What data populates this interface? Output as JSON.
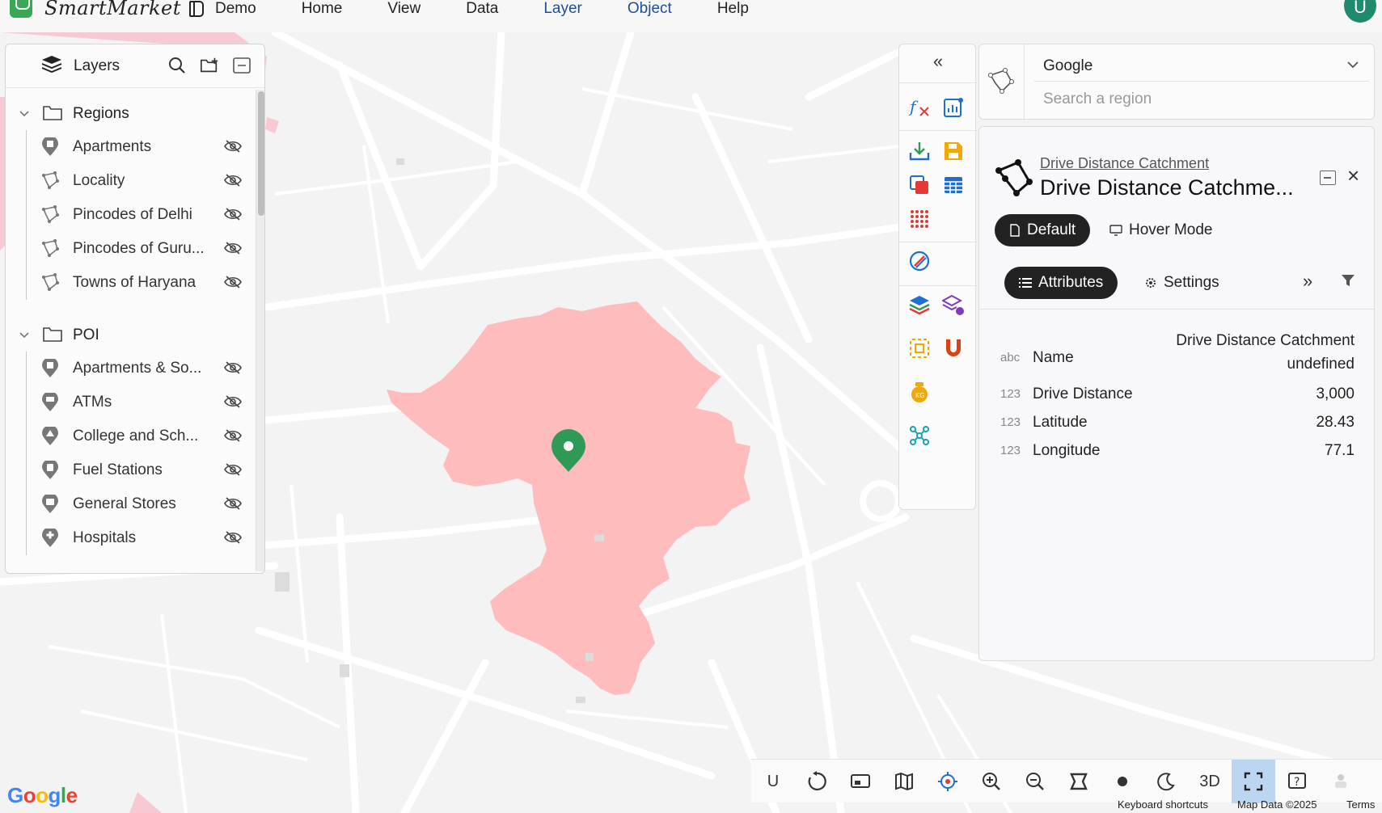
{
  "app": {
    "brand": "SmartMarket",
    "avatar_initial": "U",
    "menu": [
      {
        "label": "Demo",
        "icon": "book-icon",
        "active": false
      },
      {
        "label": "Home",
        "active": false
      },
      {
        "label": "View",
        "active": false
      },
      {
        "label": "Data",
        "active": false
      },
      {
        "label": "Layer",
        "active": true
      },
      {
        "label": "Object",
        "active": true
      },
      {
        "label": "Help",
        "active": false
      }
    ]
  },
  "layers_panel": {
    "title": "Layers",
    "groups": [
      {
        "label": "Regions",
        "items": [
          {
            "label": "Apartments",
            "icon": "pin-icon"
          },
          {
            "label": "Locality",
            "icon": "polygon-icon"
          },
          {
            "label": "Pincodes of Delhi",
            "icon": "polygon-icon"
          },
          {
            "label": "Pincodes of Guru...",
            "icon": "polygon-icon"
          },
          {
            "label": "Towns of Haryana",
            "icon": "polygon-icon"
          }
        ]
      },
      {
        "label": "POI",
        "items": [
          {
            "label": "Apartments & So...",
            "icon": "pin-icon"
          },
          {
            "label": "ATMs",
            "icon": "pin-icon"
          },
          {
            "label": "College and Sch...",
            "icon": "pin-icon"
          },
          {
            "label": "Fuel Stations",
            "icon": "pin-icon"
          },
          {
            "label": "General Stores",
            "icon": "pin-icon"
          },
          {
            "label": "Hospitals",
            "icon": "pin-icon"
          }
        ]
      }
    ]
  },
  "tool_strip": {
    "collapse_label": "«"
  },
  "region_search": {
    "provider": "Google",
    "placeholder": "Search a region"
  },
  "detail": {
    "link": "Drive Distance Catchment",
    "title": "Drive Distance Catchme...",
    "modes": {
      "default": "Default",
      "hover": "Hover Mode"
    },
    "tabs": {
      "attributes": "Attributes",
      "settings": "Settings"
    },
    "more_label": "»",
    "close_label": "×",
    "attributes": [
      {
        "type": "abc",
        "name": "Name",
        "value_line1": "Drive Distance Catchment",
        "value_line2": "undefined"
      },
      {
        "type": "123",
        "name": "Drive Distance",
        "value": "3,000"
      },
      {
        "type": "123",
        "name": "Latitude",
        "value": "28.43"
      },
      {
        "type": "123",
        "name": "Longitude",
        "value": "77.1"
      }
    ]
  },
  "bottom_bar": {
    "user_label": "U",
    "three_d_label": "3D"
  },
  "footer": {
    "google": "Google",
    "shortcuts": "Keyboard shortcuts",
    "map_data": "Map Data ©2025",
    "terms": "Terms"
  },
  "colors": {
    "catchment_fill": "#ffbcbc",
    "marker": "#2e9a55",
    "active_menu": "#1f4e96",
    "active_tool": "#bcd6f2"
  }
}
